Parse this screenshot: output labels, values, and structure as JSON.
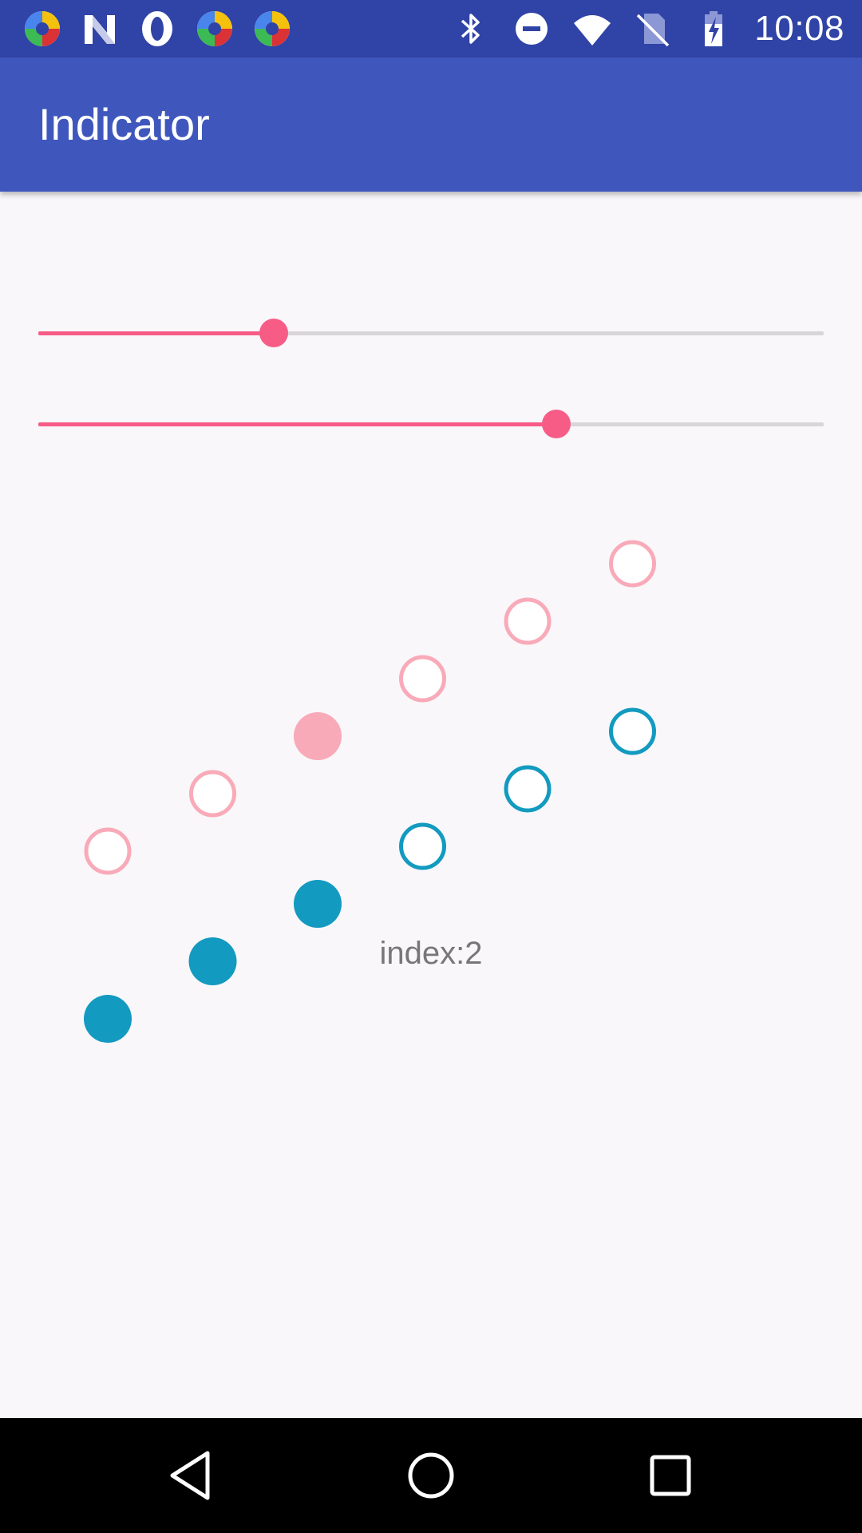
{
  "status_bar": {
    "notification_icons": [
      "multicolor-app-icon",
      "n-letter-icon",
      "o-letter-icon",
      "multicolor-app-icon",
      "multicolor-app-icon"
    ],
    "system_icons": [
      "bluetooth-icon",
      "do-not-disturb-icon",
      "wifi-icon",
      "no-sim-icon",
      "battery-charging-icon"
    ],
    "time": "10:08"
  },
  "app_bar": {
    "title": "Indicator"
  },
  "sliders": [
    {
      "value": 0.3,
      "active_color": "#f75c87",
      "inactive_color": "#d9d6da"
    },
    {
      "value": 0.66,
      "active_color": "#f75c87",
      "inactive_color": "#d9d6da"
    }
  ],
  "indicators": [
    {
      "name": "pink-indicator",
      "color": "#f9aab8",
      "count": 6,
      "selected_index": 2,
      "selected_style": "filled",
      "other_style": "outline"
    },
    {
      "name": "teal-indicator",
      "color": "#139ac0",
      "count": 6,
      "selected_index": 2,
      "up_to_selected_style": "filled",
      "after_style": "outline"
    }
  ],
  "index_text": "index:2",
  "nav_bar": {
    "buttons": [
      "back-icon",
      "home-icon",
      "recents-icon"
    ]
  },
  "colors": {
    "status_bar": "#3043a6",
    "app_bar": "#3f57bd",
    "background": "#f9f7fa",
    "accent": "#f75c87"
  }
}
